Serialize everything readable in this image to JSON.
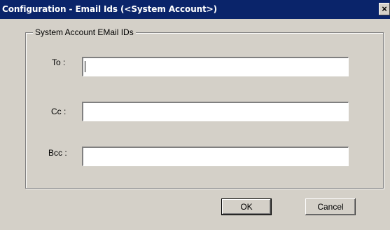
{
  "window": {
    "title": "Configuration - Email Ids (<System Account>)",
    "close_label": "×"
  },
  "group": {
    "label": "System Account EMail IDs"
  },
  "fields": {
    "to_label": "To :",
    "to_value": "",
    "cc_label": "Cc :",
    "cc_value": "",
    "bcc_label": "Bcc :",
    "bcc_value": ""
  },
  "buttons": {
    "ok_label": "OK",
    "cancel_label": "Cancel"
  }
}
